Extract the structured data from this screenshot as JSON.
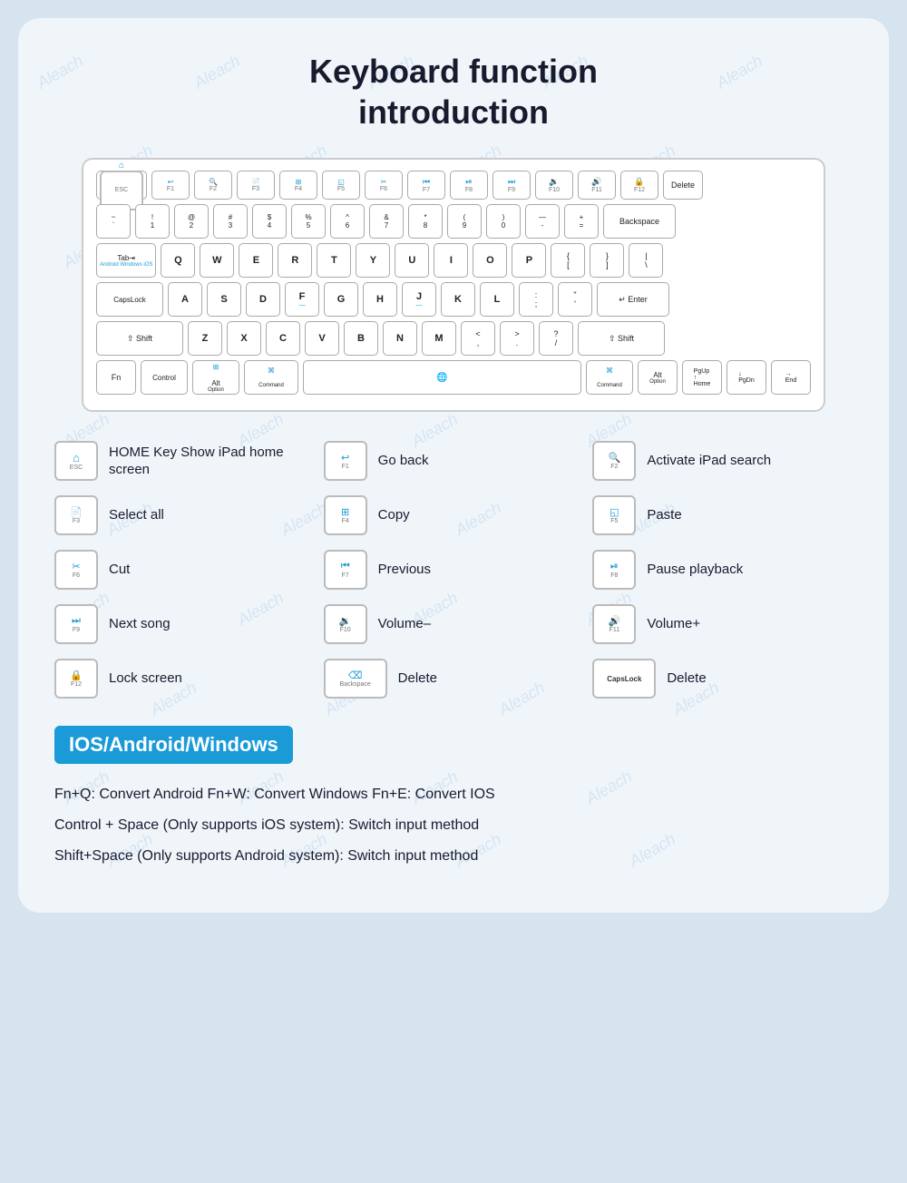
{
  "page": {
    "title_line1": "Keyboard function",
    "title_line2": "introduction",
    "watermark_text": "Aleach"
  },
  "keyboard": {
    "rows": [
      {
        "id": "fn",
        "keys": [
          {
            "label": "ESC",
            "icon": "⌂",
            "sub": ""
          },
          {
            "label": "F1",
            "icon": "↩",
            "sub": ""
          },
          {
            "label": "F2",
            "icon": "🔍",
            "sub": ""
          },
          {
            "label": "F3",
            "icon": "📄",
            "sub": ""
          },
          {
            "label": "F4",
            "icon": "⊞",
            "sub": ""
          },
          {
            "label": "F5",
            "icon": "◱",
            "sub": ""
          },
          {
            "label": "F6",
            "icon": "✂",
            "sub": ""
          },
          {
            "label": "F7",
            "icon": "|◄◄",
            "sub": ""
          },
          {
            "label": "F8",
            "icon": "►|",
            "sub": ""
          },
          {
            "label": "F9",
            "icon": "►►|",
            "sub": ""
          },
          {
            "label": "F10",
            "icon": "◄",
            "sub": ""
          },
          {
            "label": "F11",
            "icon": "►",
            "sub": ""
          },
          {
            "label": "F12",
            "icon": "🔒",
            "sub": ""
          },
          {
            "label": "Delete",
            "icon": "",
            "sub": "",
            "wide": true
          }
        ]
      }
    ]
  },
  "reference_items": [
    {
      "col": 1,
      "items": [
        {
          "key_top": "ESC",
          "key_icon": "⌂",
          "label": "HOME Key\nShow iPad home screen"
        },
        {
          "key_top": "F3",
          "key_icon": "📄",
          "label": "Select all"
        },
        {
          "key_top": "F6",
          "key_icon": "✂",
          "label": "Cut"
        },
        {
          "key_top": "F9",
          "key_icon": "►►|",
          "label": "Next song"
        },
        {
          "key_top": "F12",
          "key_icon": "🔒",
          "label": "Lock screen"
        }
      ]
    },
    {
      "col": 2,
      "items": [
        {
          "key_top": "F1",
          "key_icon": "↩",
          "label": "Go back"
        },
        {
          "key_top": "F4",
          "key_icon": "⊞",
          "label": "Copy"
        },
        {
          "key_top": "F7",
          "key_icon": "|◄◄",
          "label": "Previous"
        },
        {
          "key_top": "F10",
          "key_icon": "◄",
          "label": "Volume–"
        },
        {
          "key_top": "Backspace",
          "key_icon": "⌫",
          "label": "Delete",
          "wide": true
        }
      ]
    },
    {
      "col": 3,
      "items": [
        {
          "key_top": "F2",
          "key_icon": "🔍",
          "label": "Activate iPad search"
        },
        {
          "key_top": "F5",
          "key_icon": "◱",
          "label": "Paste"
        },
        {
          "key_top": "F8",
          "key_icon": "►|",
          "label": "Pause playback"
        },
        {
          "key_top": "F11",
          "key_icon": "►",
          "label": "Volume+"
        },
        {
          "key_top": "CapsLock",
          "key_icon": "",
          "label": "Delete",
          "caps": true
        }
      ]
    }
  ],
  "ios_section": {
    "banner": "IOS/Android/Windows",
    "shortcuts": [
      {
        "text": "Fn+Q: Convert Android     Fn+W: Convert Windows     Fn+E: Convert IOS"
      },
      {
        "text": "Control + Space (Only supports iOS system): Switch input method"
      },
      {
        "text": "Shift+Space (Only supports Android system): Switch input method"
      }
    ]
  }
}
